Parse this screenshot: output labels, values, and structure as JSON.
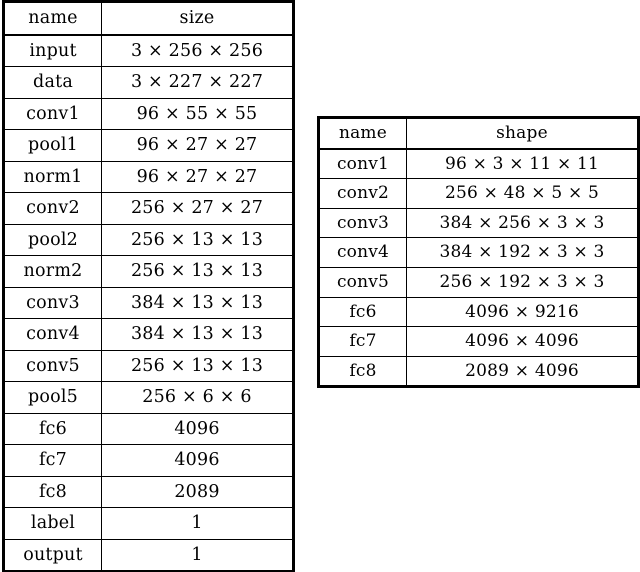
{
  "document": {
    "kind": "two-latex-tables",
    "background_color": "#ffffff",
    "text_color": "#000000"
  },
  "tables": [
    {
      "id": "table-sizes",
      "name": "blob-sizes-table",
      "headers": [
        "name",
        "size"
      ],
      "rows": [
        [
          "input",
          "3 × 256 × 256"
        ],
        [
          "data",
          "3 × 227 × 227"
        ],
        [
          "conv1",
          "96 × 55 × 55"
        ],
        [
          "pool1",
          "96 × 27 × 27"
        ],
        [
          "norm1",
          "96 × 27 × 27"
        ],
        [
          "conv2",
          "256 × 27 × 27"
        ],
        [
          "pool2",
          "256 × 13 × 13"
        ],
        [
          "norm2",
          "256 × 13 × 13"
        ],
        [
          "conv3",
          "384 × 13 × 13"
        ],
        [
          "conv4",
          "384 × 13 × 13"
        ],
        [
          "conv5",
          "256 × 13 × 13"
        ],
        [
          "pool5",
          "256 × 6 × 6"
        ],
        [
          "fc6",
          "4096"
        ],
        [
          "fc7",
          "4096"
        ],
        [
          "fc8",
          "2089"
        ],
        [
          "label",
          "1"
        ],
        [
          "output",
          "1"
        ]
      ]
    },
    {
      "id": "table-shapes",
      "name": "layer-parameter-shapes-table",
      "headers": [
        "name",
        "shape"
      ],
      "rows": [
        [
          "conv1",
          "96 × 3 × 11 × 11"
        ],
        [
          "conv2",
          "256 × 48 × 5 × 5"
        ],
        [
          "conv3",
          "384 × 256 × 3 × 3"
        ],
        [
          "conv4",
          "384 × 192 × 3 × 3"
        ],
        [
          "conv5",
          "256 × 192 × 3 × 3"
        ],
        [
          "fc6",
          "4096 × 9216"
        ],
        [
          "fc7",
          "4096 × 4096"
        ],
        [
          "fc8",
          "2089 × 4096"
        ]
      ]
    }
  ]
}
